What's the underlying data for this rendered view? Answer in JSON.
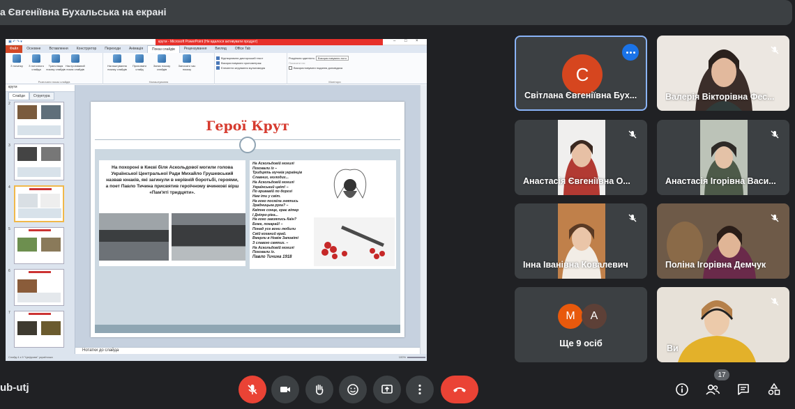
{
  "banner": {
    "text": "а Євгеніївна Бухальська на екрані"
  },
  "powerpoint": {
    "window_title": "крути - Microsoft PowerPoint (Не вдалося активувати продукт)",
    "tabs": [
      "Файл",
      "Основне",
      "Вставлення",
      "Конструктор",
      "Переходи",
      "Анімація",
      "Показ слайдів",
      "Рецензування",
      "Вигляд",
      "Office Tab"
    ],
    "active_tab": "Показ слайдів",
    "ribbon_buttons": [
      "З початку",
      "З поточного слайда",
      "Трансляція показу слайдів",
      "Настроюваний показ слайдів",
      "Налаштування показу слайдів",
      "Приховати слайд",
      "Запис показу слайдів",
      "Записати час показу"
    ],
    "ribbon_groups": [
      "Розпочати показ слайдів",
      "Налаштування",
      "Монітори"
    ],
    "ribbon_checks": [
      "Відтворювати дикторський текст",
      "Використовувати хронометраж",
      "Елементи керування мультимедіа"
    ],
    "monitor_label": "Роздільна здатність:",
    "monitor_value": "Використовувати пото",
    "monitor_show_on": "Показати на:",
    "monitor_presenter": "Використовувати подання доповідача",
    "doc_tab": "крути",
    "left_tabs": [
      "Слайди",
      "Структура"
    ],
    "slide_numbers": [
      "2",
      "3",
      "4",
      "5",
      "6",
      "7"
    ],
    "notes_placeholder": "Нотатки до слайда",
    "status_left": "Слайд 4 з 9    \"Цифрова\"    українська",
    "zoom": "100%",
    "slide": {
      "title": "Герої Крут",
      "left_text": "На похороні в Києві біля Аскольдової могили голова Української Центральної Ради Михайло Грушевський назвав юнаків, які загинули в нерівній боротьбі, героями, а поет Павло Тичина присвятив героїчному вчинкові вірш «Пам'яті тридцяти».",
      "poem": "На Аскольдовій могилі\nПоховали їх –\nТридцять мучнів українців\nСлавних, молодих...\nНа Аскольдовій могилі\nУкраїнський цвіт! –\nПо кривавій по дорозі\nНам іти у світ.\nНа кого посміла знятись\nЗрадницька рука? –\nКвітне сонце, грає вітер\nІ Дніпро-ріка...\nНа кого завзялись Каїн?\nБоже, покарай! –\nПонад усе вони любили\nСвій коханий край.\nВмерли в Новім Заповіті\nЗ славою святих. –\nНа Аскольдовій могилі\nПоховали їх.",
      "poem_author": "Павло Тичина 1918"
    }
  },
  "participants": [
    {
      "name": "Світлана Євгеніївна Бух...",
      "avatar_letter": "C",
      "avatar_color": "#d6461f"
    },
    {
      "name": "Валерія Вікторівна Фес..."
    },
    {
      "name": "Анастасія Євгеніївна О..."
    },
    {
      "name": "Анастасія Ігорівна Васи..."
    },
    {
      "name": "Інна Іванівна Ковалевич"
    },
    {
      "name": "Поліна Ігорівна Демчук"
    },
    {
      "name": "Ви"
    }
  ],
  "others": {
    "letters": [
      "M",
      "A"
    ],
    "colors": [
      "#e8590c",
      "#5d4037"
    ],
    "label": "Ще 9 осіб"
  },
  "bottom": {
    "meeting_code": "ub-utj",
    "participants_count": "17"
  }
}
